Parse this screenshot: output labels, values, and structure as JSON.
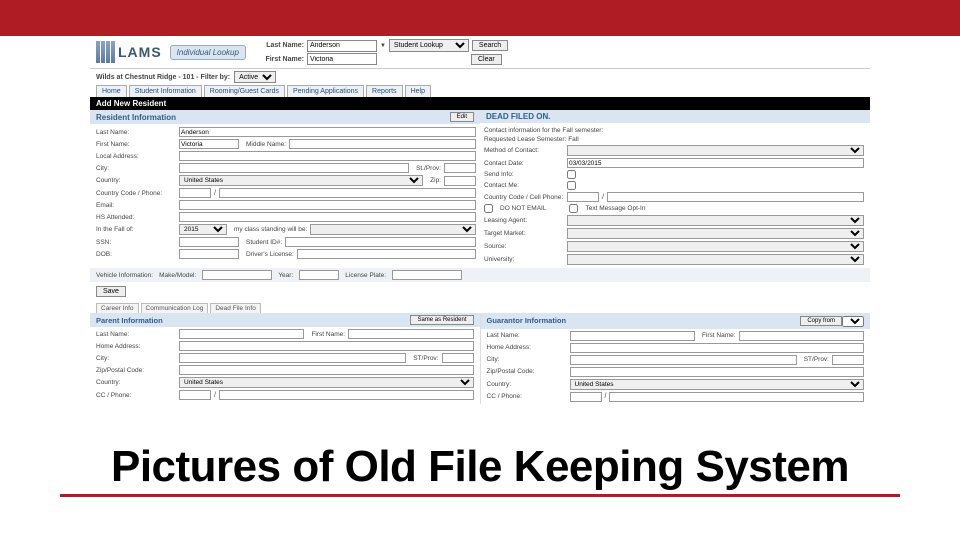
{
  "header": {
    "logo_text": "LAMS",
    "lookup_badge": "Individual Lookup",
    "last_name_label": "Last Name:",
    "last_name_value": "Anderson",
    "first_name_label": "First Name:",
    "first_name_value": "Victoria",
    "lookup_mode": "Student Lookup",
    "search_btn": "Search",
    "clear_btn": "Clear"
  },
  "statusbar": {
    "text": "Wilds at Chestnut Ridge - 101 - Filter by: ",
    "filter_value": "Active"
  },
  "tabs": [
    "Home",
    "Student Information",
    "Rooming/Guest Cards",
    "Pending Applications",
    "Reports",
    "Help"
  ],
  "section_title": "Add New Resident",
  "resident_hdr": "Resident Information",
  "edit_btn": "Edit",
  "dead_hdr": "DEAD FILED ON.",
  "left": {
    "last_name": {
      "label": "Last Name:",
      "value": "Anderson"
    },
    "first_name_label": "First Name:",
    "first_name_value": "Victoria",
    "middle_label": "Middle Name:",
    "local_addr": "Local Address:",
    "city_label": "City:",
    "stprov_label": "St./Prov:",
    "country_label": "Country:",
    "country_value": "United States",
    "zip_label": "Zip:",
    "cc_phone_label": "Country Code / Phone:",
    "email_label": "Email:",
    "hs_label": "HS Attended:",
    "fall_label": "In the Fall of:",
    "fall_value": "2015",
    "standing_label": "my class standing will be:",
    "ssn_label": "SSN:",
    "studentid_label": "Student ID#:",
    "dob_label": "DOB:",
    "dl_label": "Driver's License:"
  },
  "right": {
    "contact_info": "Contact information for the Fall semester:",
    "req_lease": "Requested Lease Semester: Fall",
    "method_label": "Method of Contact:",
    "contact_date_label": "Contact Date:",
    "contact_date_value": "03/03/2015",
    "send_info_label": "Send Info:",
    "contact_me_label": "Contact Me:",
    "cc_cell_label": "Country Code / Cell Phone:",
    "no_email_label": "DO NOT EMAIL",
    "text_optin_label": "Text Message Opt-In",
    "leasing_agent_label": "Leasing Agent:",
    "target_market_label": "Target Market:",
    "source_label": "Source:",
    "university_label": "University:"
  },
  "vehicle": {
    "info_label": "Vehicle Information:",
    "make_label": "Make/Model:",
    "year_label": "Year:",
    "plate_label": "License Plate:"
  },
  "save_btn": "Save",
  "subtabs": [
    "Career Info",
    "Communication Log",
    "Dead File Info"
  ],
  "parent": {
    "hdr": "Parent Information",
    "same_btn": "Same as Resident",
    "last_name_label": "Last Name:",
    "first_name_label": "First Name:",
    "home_addr_label": "Home Address:",
    "city_label": "City:",
    "stprov_label": "ST/Prov:",
    "zip_label": "Zip/Postal Code:",
    "country_label": "Country:",
    "country_value": "United States",
    "phone_label": "CC / Phone:"
  },
  "guarantor": {
    "hdr": "Guarantor Information",
    "copy_btn": "Copy from",
    "last_name_label": "Last Name:",
    "first_name_label": "First Name:",
    "home_addr_label": "Home Address:",
    "city_label": "City:",
    "stprov_label": "ST/Prov:",
    "zip_label": "Zip/Postal Code:",
    "country_label": "Country:",
    "country_value": "United States",
    "phone_label": "CC / Phone:"
  },
  "caption": "Pictures of Old File Keeping System"
}
